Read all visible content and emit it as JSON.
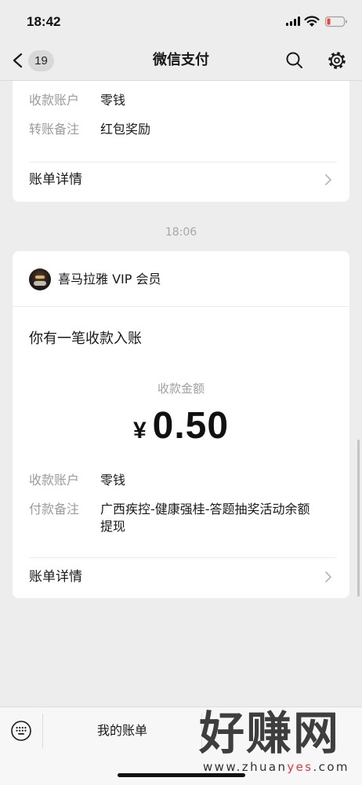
{
  "status_bar": {
    "time": "18:42"
  },
  "nav": {
    "back_badge": "19",
    "title": "微信支付"
  },
  "messages": [
    {
      "rows": [
        {
          "label": "收款账户",
          "value": "零钱"
        },
        {
          "label": "转账备注",
          "value": "红包奖励"
        }
      ],
      "detail_link": "账单详情"
    },
    {
      "timestamp": "18:06",
      "sender": "喜马拉雅 VIP 会员",
      "headline": "你有一笔收款入账",
      "amount_label": "收款金额",
      "currency": "¥",
      "amount": "0.50",
      "rows": [
        {
          "label": "收款账户",
          "value": "零钱"
        },
        {
          "label": "付款备注",
          "value": "广西疾控-健康强桂-答题抽奖活动余额提现"
        }
      ],
      "detail_link": "账单详情"
    }
  ],
  "bottom_menu": {
    "items": [
      {
        "label": "我的账单"
      }
    ]
  },
  "watermark": {
    "title": "好赚网",
    "url_prefix": "www.zhuan",
    "url_highlight": "yes",
    "url_suffix": ".com"
  },
  "icons": {
    "back": "chevron-left-icon",
    "search": "search-icon",
    "settings": "gear-icon",
    "detail": "chevron-right-icon",
    "keyboard": "keyboard-icon",
    "signal": "cellular-signal-icon",
    "wifi": "wifi-icon",
    "battery": "battery-low-icon"
  },
  "colors": {
    "background": "#ededed",
    "card": "#ffffff",
    "label": "#9b9b9b",
    "text": "#191919",
    "battery_low": "#ff3b30",
    "watermark_highlight": "#e5393d"
  }
}
